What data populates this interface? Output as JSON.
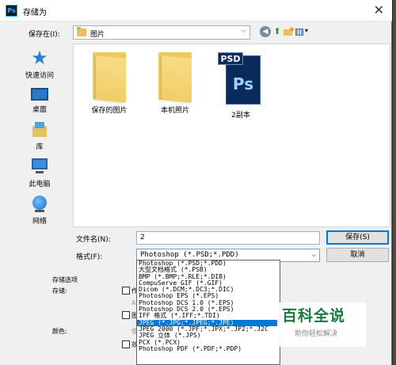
{
  "window": {
    "title": "存储为",
    "app_icon": "Ps",
    "close": "✕"
  },
  "save_in": {
    "label": "保存在(I):",
    "value": "图片",
    "arrow": "⌵"
  },
  "nav": {
    "back": "◀",
    "up": "⬆",
    "view_arrow": "▾"
  },
  "places": [
    {
      "label": "快速访问",
      "icon": "star-icon"
    },
    {
      "label": "桌面",
      "icon": "desktop-icon"
    },
    {
      "label": "库",
      "icon": "library-icon"
    },
    {
      "label": "此电脑",
      "icon": "computer-icon"
    },
    {
      "label": "网络",
      "icon": "network-icon"
    }
  ],
  "files": [
    {
      "name": "保存的图片",
      "type": "folder"
    },
    {
      "name": "本机照片",
      "type": "folder"
    },
    {
      "name": "2副本",
      "type": "psd",
      "tag": "PSD",
      "glyph": "Ps"
    }
  ],
  "filename": {
    "label": "文件名(N):",
    "value": "2"
  },
  "format": {
    "label": "格式(F):",
    "value": "Photoshop (*.PSD;*.PDD)"
  },
  "buttons": {
    "save": "保存(S)",
    "cancel": "取消"
  },
  "options": {
    "group_label": "存储选项",
    "save_label": "存储:",
    "color_label": "颜色:",
    "partial": [
      "作",
      "A",
      "图",
      "使",
      "效"
    ]
  },
  "format_options": [
    "Photoshop (*.PSD;*.PDD)",
    "大型文档格式 (*.PSB)",
    "BMP (*.BMP;*.RLE;*.DIB)",
    "CompuServe GIF (*.GIF)",
    "Dicom (*.DCM;*.DC3;*.DIC)",
    "Photoshop EPS (*.EPS)",
    "Photoshop DCS 1.0 (*.EPS)",
    "Photoshop DCS 2.0 (*.EPS)",
    "IFF 格式 (*.IFF;*.TDI)",
    "JPEG (*.JPG;*.JPEG;*.JPE)",
    "JPEG 2000 (*.JPF;*.JPX;*.JP2;*.J2C",
    "JPEG 立体 (*.JPS)",
    "PCX (*.PCX)",
    "Photoshop PDF (*.PDF;*.PDP)"
  ],
  "selected_format_index": 9,
  "watermark": {
    "main": "百科全说",
    "sub": "助你轻松解决"
  }
}
